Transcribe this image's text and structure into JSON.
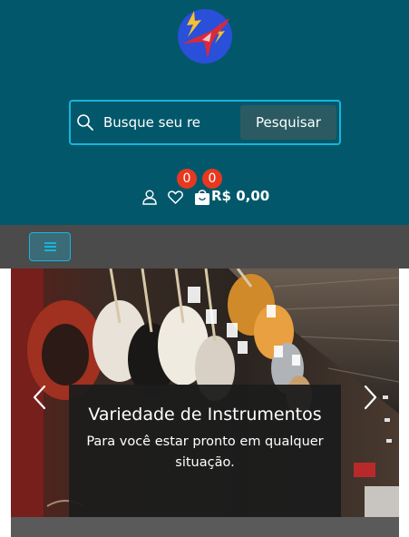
{
  "search": {
    "placeholder": "Busque seu re",
    "button_label": "Pesquisar"
  },
  "header_icons": {
    "wishlist_count": "0",
    "cart_count": "0",
    "cart_total": "R$ 0,00"
  },
  "carousel": {
    "title": "Variedade de Instrumentos",
    "subtitle": "Para você estar pronto em qualquer situação."
  },
  "colors": {
    "header_bg": "#02586a",
    "accent": "#18b4dc",
    "badge": "#e8381f",
    "navbar_bg": "#4b4b4b"
  },
  "icons": [
    "logo-icon",
    "search-icon",
    "user-icon",
    "heart-icon",
    "cart-icon",
    "menu-icon",
    "chevron-left-icon",
    "chevron-right-icon"
  ]
}
